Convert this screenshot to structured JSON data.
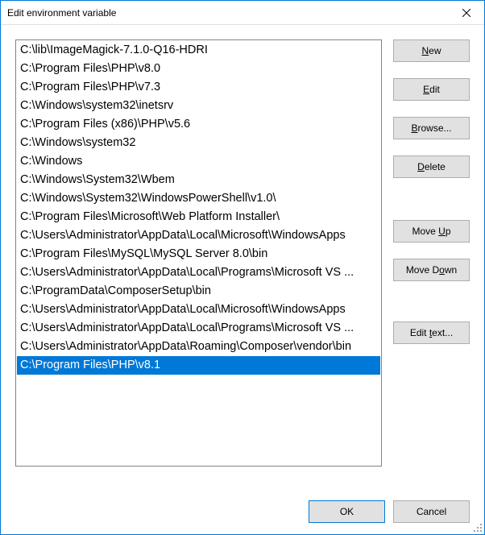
{
  "title": "Edit environment variable",
  "list": {
    "items": [
      "C:\\lib\\ImageMagick-7.1.0-Q16-HDRI",
      "C:\\Program Files\\PHP\\v8.0",
      "C:\\Program Files\\PHP\\v7.3",
      "C:\\Windows\\system32\\inetsrv",
      "C:\\Program Files (x86)\\PHP\\v5.6",
      "C:\\Windows\\system32",
      "C:\\Windows",
      "C:\\Windows\\System32\\Wbem",
      "C:\\Windows\\System32\\WindowsPowerShell\\v1.0\\",
      "C:\\Program Files\\Microsoft\\Web Platform Installer\\",
      "C:\\Users\\Administrator\\AppData\\Local\\Microsoft\\WindowsApps",
      "C:\\Program Files\\MySQL\\MySQL Server 8.0\\bin",
      "C:\\Users\\Administrator\\AppData\\Local\\Programs\\Microsoft VS ...",
      "C:\\ProgramData\\ComposerSetup\\bin",
      "C:\\Users\\Administrator\\AppData\\Local\\Microsoft\\WindowsApps",
      "C:\\Users\\Administrator\\AppData\\Local\\Programs\\Microsoft VS ...",
      "C:\\Users\\Administrator\\AppData\\Roaming\\Composer\\vendor\\bin",
      "C:\\Program Files\\PHP\\v8.1"
    ],
    "selected_index": 17
  },
  "buttons": {
    "new_pre": "",
    "new_u": "N",
    "new_post": "ew",
    "edit_pre": "",
    "edit_u": "E",
    "edit_post": "dit",
    "browse_pre": "",
    "browse_u": "B",
    "browse_post": "rowse...",
    "delete_pre": "",
    "delete_u": "D",
    "delete_post": "elete",
    "moveup_pre": "Move ",
    "moveup_u": "U",
    "moveup_post": "p",
    "movedown_pre": "Move D",
    "movedown_u": "o",
    "movedown_post": "wn",
    "edittext_pre": "Edit ",
    "edittext_u": "t",
    "edittext_post": "ext...",
    "ok": "OK",
    "cancel": "Cancel"
  }
}
